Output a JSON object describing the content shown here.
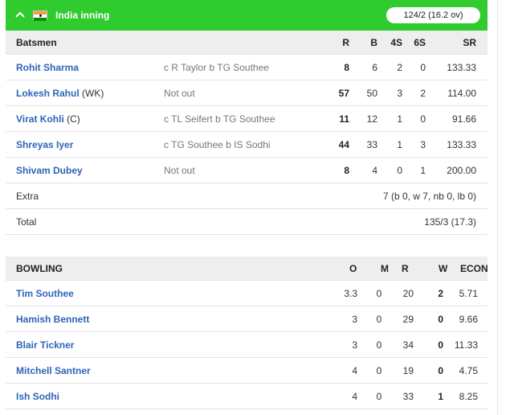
{
  "header": {
    "title": "India inning",
    "score": "124/2 (16.2 ov)",
    "collapse_icon": "chevron-up-icon",
    "flag_icon": "india-flag-icon",
    "bg_color": "#2fcb2f"
  },
  "batting": {
    "columns": {
      "name": "Batsmen",
      "r": "R",
      "b": "B",
      "fours": "4S",
      "sixes": "6S",
      "sr": "SR"
    },
    "rows": [
      {
        "name": "Rohit Sharma",
        "tag": "",
        "dismissal": "c R Taylor b TG Southee",
        "r": "8",
        "b": "6",
        "fours": "2",
        "sixes": "0",
        "sr": "133.33"
      },
      {
        "name": "Lokesh Rahul",
        "tag": " (WK)",
        "dismissal": "Not out",
        "r": "57",
        "b": "50",
        "fours": "3",
        "sixes": "2",
        "sr": "114.00"
      },
      {
        "name": "Virat Kohli",
        "tag": " (C)",
        "dismissal": "c TL Seifert b TG Southee",
        "r": "11",
        "b": "12",
        "fours": "1",
        "sixes": "0",
        "sr": "91.66"
      },
      {
        "name": "Shreyas Iyer",
        "tag": "",
        "dismissal": "c TG Southee b IS Sodhi",
        "r": "44",
        "b": "33",
        "fours": "1",
        "sixes": "3",
        "sr": "133.33"
      },
      {
        "name": "Shivam Dubey",
        "tag": "",
        "dismissal": "Not out",
        "r": "8",
        "b": "4",
        "fours": "0",
        "sixes": "1",
        "sr": "200.00"
      }
    ],
    "extra": {
      "label": "Extra",
      "value": "7 (b 0, w 7, nb 0, lb 0)"
    },
    "total": {
      "label": "Total",
      "value": "135/3 (17.3)"
    }
  },
  "bowling": {
    "columns": {
      "name": "BOWLING",
      "o": "O",
      "m": "M",
      "r": "R",
      "w": "W",
      "econ": "ECON"
    },
    "rows": [
      {
        "name": "Tim Southee",
        "o": "3.3",
        "m": "0",
        "r": "20",
        "w": "2",
        "econ": "5.71"
      },
      {
        "name": "Hamish Bennett",
        "o": "3",
        "m": "0",
        "r": "29",
        "w": "0",
        "econ": "9.66"
      },
      {
        "name": "Blair Tickner",
        "o": "3",
        "m": "0",
        "r": "34",
        "w": "0",
        "econ": "11.33"
      },
      {
        "name": "Mitchell Santner",
        "o": "4",
        "m": "0",
        "r": "19",
        "w": "0",
        "econ": "4.75"
      },
      {
        "name": "Ish Sodhi",
        "o": "4",
        "m": "0",
        "r": "33",
        "w": "1",
        "econ": "8.25"
      }
    ]
  }
}
